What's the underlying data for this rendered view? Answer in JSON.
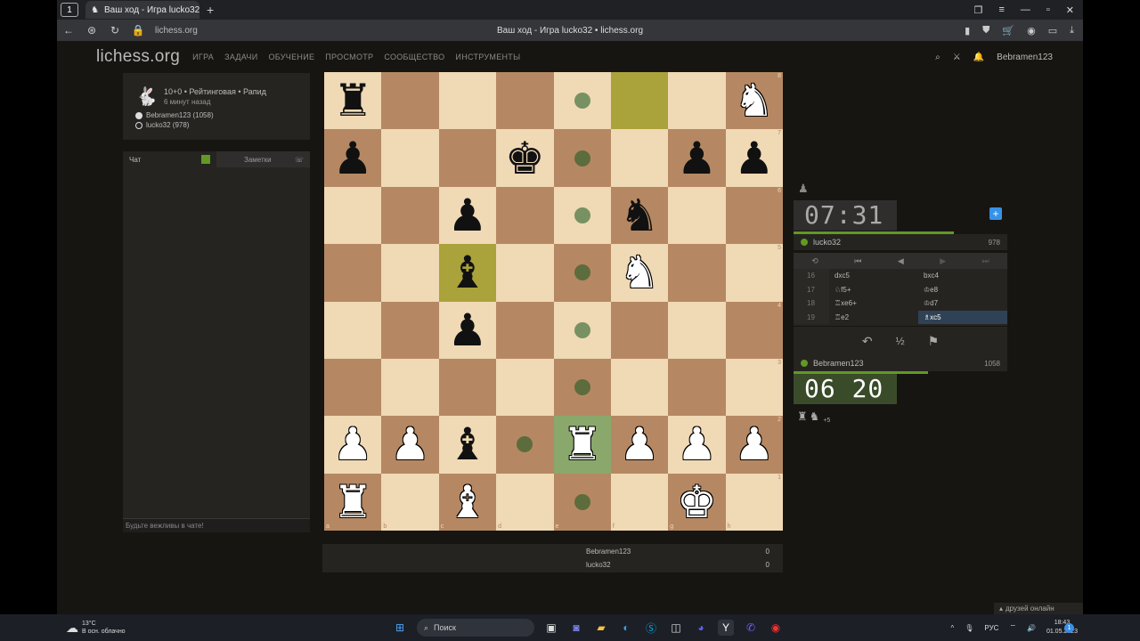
{
  "browser": {
    "tab_count": "1",
    "tab_title": "Ваш ход - Игра lucko32",
    "address": "lichess.org",
    "page_title": "Ваш ход - Игра lucko32 • lichess.org"
  },
  "header": {
    "logo": "lichess.org",
    "nav": [
      "ИГРА",
      "ЗАДАЧИ",
      "ОБУЧЕНИЕ",
      "ПРОСМОТР",
      "СООБЩЕСТВО",
      "ИНСТРУМЕНТЫ"
    ],
    "username": "Bebramen123"
  },
  "game_info": {
    "type": "10+0 • Рейтинговая • Рапид",
    "time_ago": "6 минут назад",
    "white_player": "Bebramen123 (1058)",
    "black_player": "lucko32 (978)"
  },
  "chat": {
    "tab_chat": "Чат",
    "tab_notes": "Заметки",
    "placeholder": "Будьте вежливы в чате!"
  },
  "board": {
    "rows": [
      [
        "r",
        "",
        "",
        "",
        "",
        "",
        "",
        "N"
      ],
      [
        "p",
        "",
        "",
        "k",
        "",
        "",
        "p",
        "p"
      ],
      [
        "",
        "",
        "p",
        "",
        "",
        "n",
        "",
        ""
      ],
      [
        "",
        "",
        "b",
        "",
        "",
        "N",
        "",
        ""
      ],
      [
        "",
        "",
        "p",
        "",
        "",
        "",
        "",
        ""
      ],
      [
        "",
        "",
        "",
        "",
        "",
        "",
        "",
        ""
      ],
      [
        "P",
        "P",
        "b",
        "",
        "R",
        "P",
        "P",
        "P"
      ],
      [
        "R",
        "",
        "B",
        "",
        "",
        "",
        "K",
        ""
      ]
    ],
    "highlight": [
      "f8",
      "c5"
    ],
    "move_dots": [
      "e8",
      "e7",
      "e6",
      "e5",
      "e4",
      "e3",
      "d2",
      "e1"
    ],
    "check_square": "e2",
    "files": [
      "a",
      "b",
      "c",
      "d",
      "e",
      "f",
      "g",
      "h"
    ],
    "ranks": [
      "8",
      "7",
      "6",
      "5",
      "4",
      "3",
      "2",
      "1"
    ]
  },
  "scores": {
    "rows": [
      {
        "name": "Bebramen123",
        "score": "0"
      },
      {
        "name": "lucko32",
        "score": "0"
      }
    ]
  },
  "opponent": {
    "clock": "07:31",
    "name": "lucko32",
    "rating": "978",
    "time_fraction": 0.75
  },
  "player": {
    "clock": "06 20",
    "name": "Bebramen123",
    "rating": "1058",
    "material": "+5",
    "time_fraction": 0.63
  },
  "moves": [
    {
      "num": "16",
      "white": "dxc5",
      "black": "bxc4"
    },
    {
      "num": "17",
      "white": "♘f5+",
      "black": "♔e8"
    },
    {
      "num": "18",
      "white": "♖xe6+",
      "black": "♔d7"
    },
    {
      "num": "19",
      "white": "♖e2",
      "black": "♗xc5"
    }
  ],
  "taskbar": {
    "temp": "13°C",
    "weather": "В осн. облачно",
    "search": "Поиск",
    "lang": "РУС",
    "time": "18:43",
    "date": "01.05.2023",
    "friends": "друзей онлайн"
  },
  "colors": {
    "bg": "#161512",
    "light_square": "#f0d9b5",
    "dark_square": "#b58863",
    "highlight": "#aaa23a",
    "online": "#629924"
  }
}
